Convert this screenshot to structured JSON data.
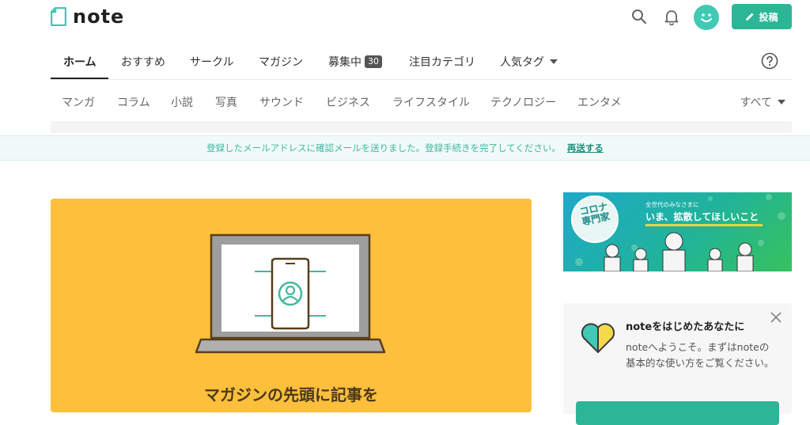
{
  "header": {
    "logo_text": "note",
    "post_label": "投稿",
    "icons": [
      "search-icon",
      "bell-icon",
      "pencil-icon"
    ],
    "colors": {
      "accent": "#2cb696",
      "avatar": "#41c9b4"
    }
  },
  "tabs": [
    {
      "label": "ホーム",
      "active": true
    },
    {
      "label": "おすすめ"
    },
    {
      "label": "サークル"
    },
    {
      "label": "マガジン"
    },
    {
      "label": "募集中",
      "badge": "30"
    },
    {
      "label": "注目カテゴリ"
    },
    {
      "label": "人気タグ"
    }
  ],
  "categories": [
    "マンガ",
    "コラム",
    "小説",
    "写真",
    "サウンド",
    "ビジネス",
    "ライフスタイル",
    "テクノロジー",
    "エンタメ"
  ],
  "categories_all_label": "すべて",
  "notice": {
    "text": "登録したメールアドレスに確認メールを送りました。登録手続きを完了してください。",
    "link": "再送する"
  },
  "main_card": {
    "title": "マガジンの先頭に記事を",
    "bg_color": "#fdbf3c"
  },
  "banner": {
    "badge_text": "コロナ\n専門家",
    "sub_text": "全世代のみなさまに",
    "main_text": "いま、拡散してほしいこと"
  },
  "welcome": {
    "title": "noteをはじめたあなたに",
    "body": "noteへようこそ。まずはnoteの基本的な使い方をご覧ください。"
  }
}
